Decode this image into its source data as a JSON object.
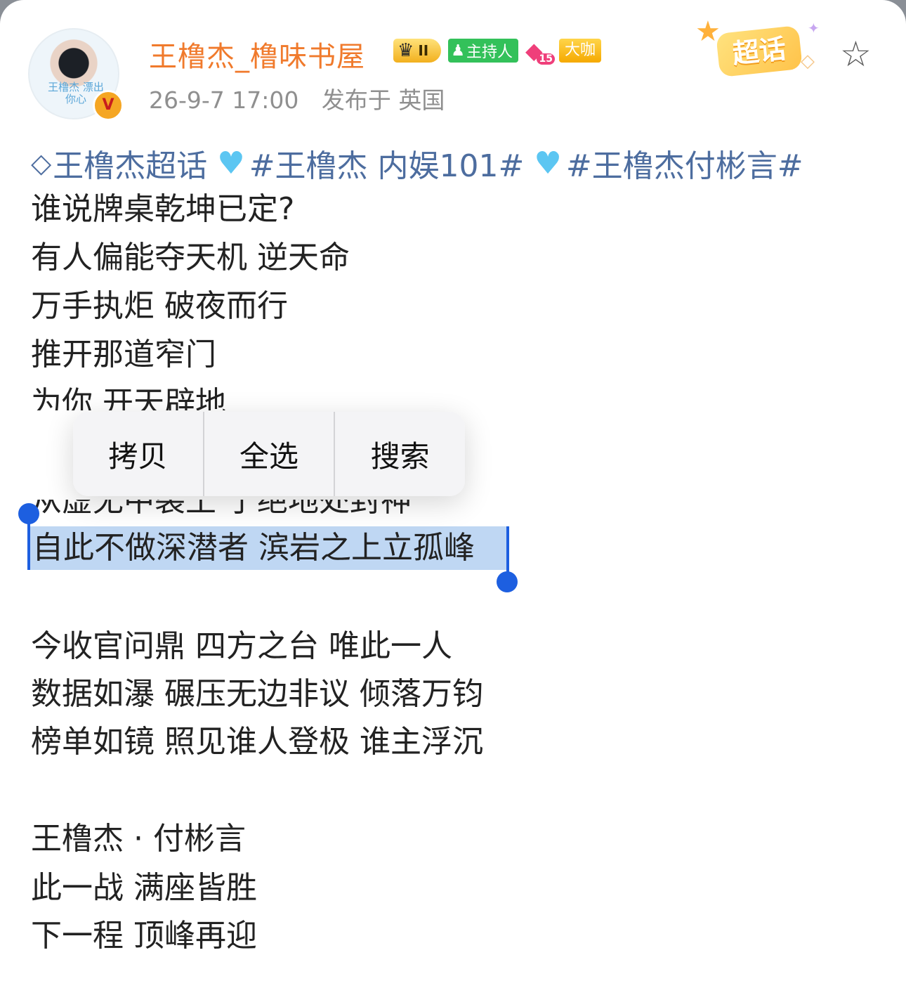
{
  "user": {
    "name": "王橹杰_橹味书屋",
    "avatar_caption": "王橹杰 漂出你心",
    "verify_mark": "V",
    "meta": {
      "time": "26-9-7 17:00",
      "location": "发布于 英国"
    }
  },
  "badges": {
    "crown_level": "II",
    "host": "主持人",
    "gem_level": "15",
    "vip": "大咖",
    "supertopic": "超话"
  },
  "post": {
    "topics": [
      {
        "icon": "diamond-icon",
        "text": "王橹杰超话"
      },
      {
        "icon": "heart-icon",
        "text": "#王橹杰 内娱101#"
      },
      {
        "icon": "heart-icon",
        "text": "#王橹杰付彬言#"
      }
    ],
    "lines": [
      "谁说牌桌乾坤已定?",
      "有人偏能夺天机 逆天命",
      "万手执炬 破夜而行",
      "推开那道窄门",
      "为你 开天辟地",
      "从虚无中裂土 于绝地处封神",
      "自此不做深潜者 滨岩之上立孤峰",
      "今收官问鼎 四方之台 唯此一人",
      "数据如瀑 碾压无边非议 倾落万钧",
      "榜单如镜 照见谁人登极 谁主浮沉",
      "王橹杰 · 付彬言",
      "此一战 满座皆胜",
      "下一程 顶峰再迎"
    ]
  },
  "context_menu": {
    "copy": "拷贝",
    "select_all": "全选",
    "search": "搜索"
  },
  "colors": {
    "username": "#f07a2c",
    "topic": "#4d6d9f",
    "selection": "#bfd7f3",
    "handle": "#1d5fe0"
  }
}
